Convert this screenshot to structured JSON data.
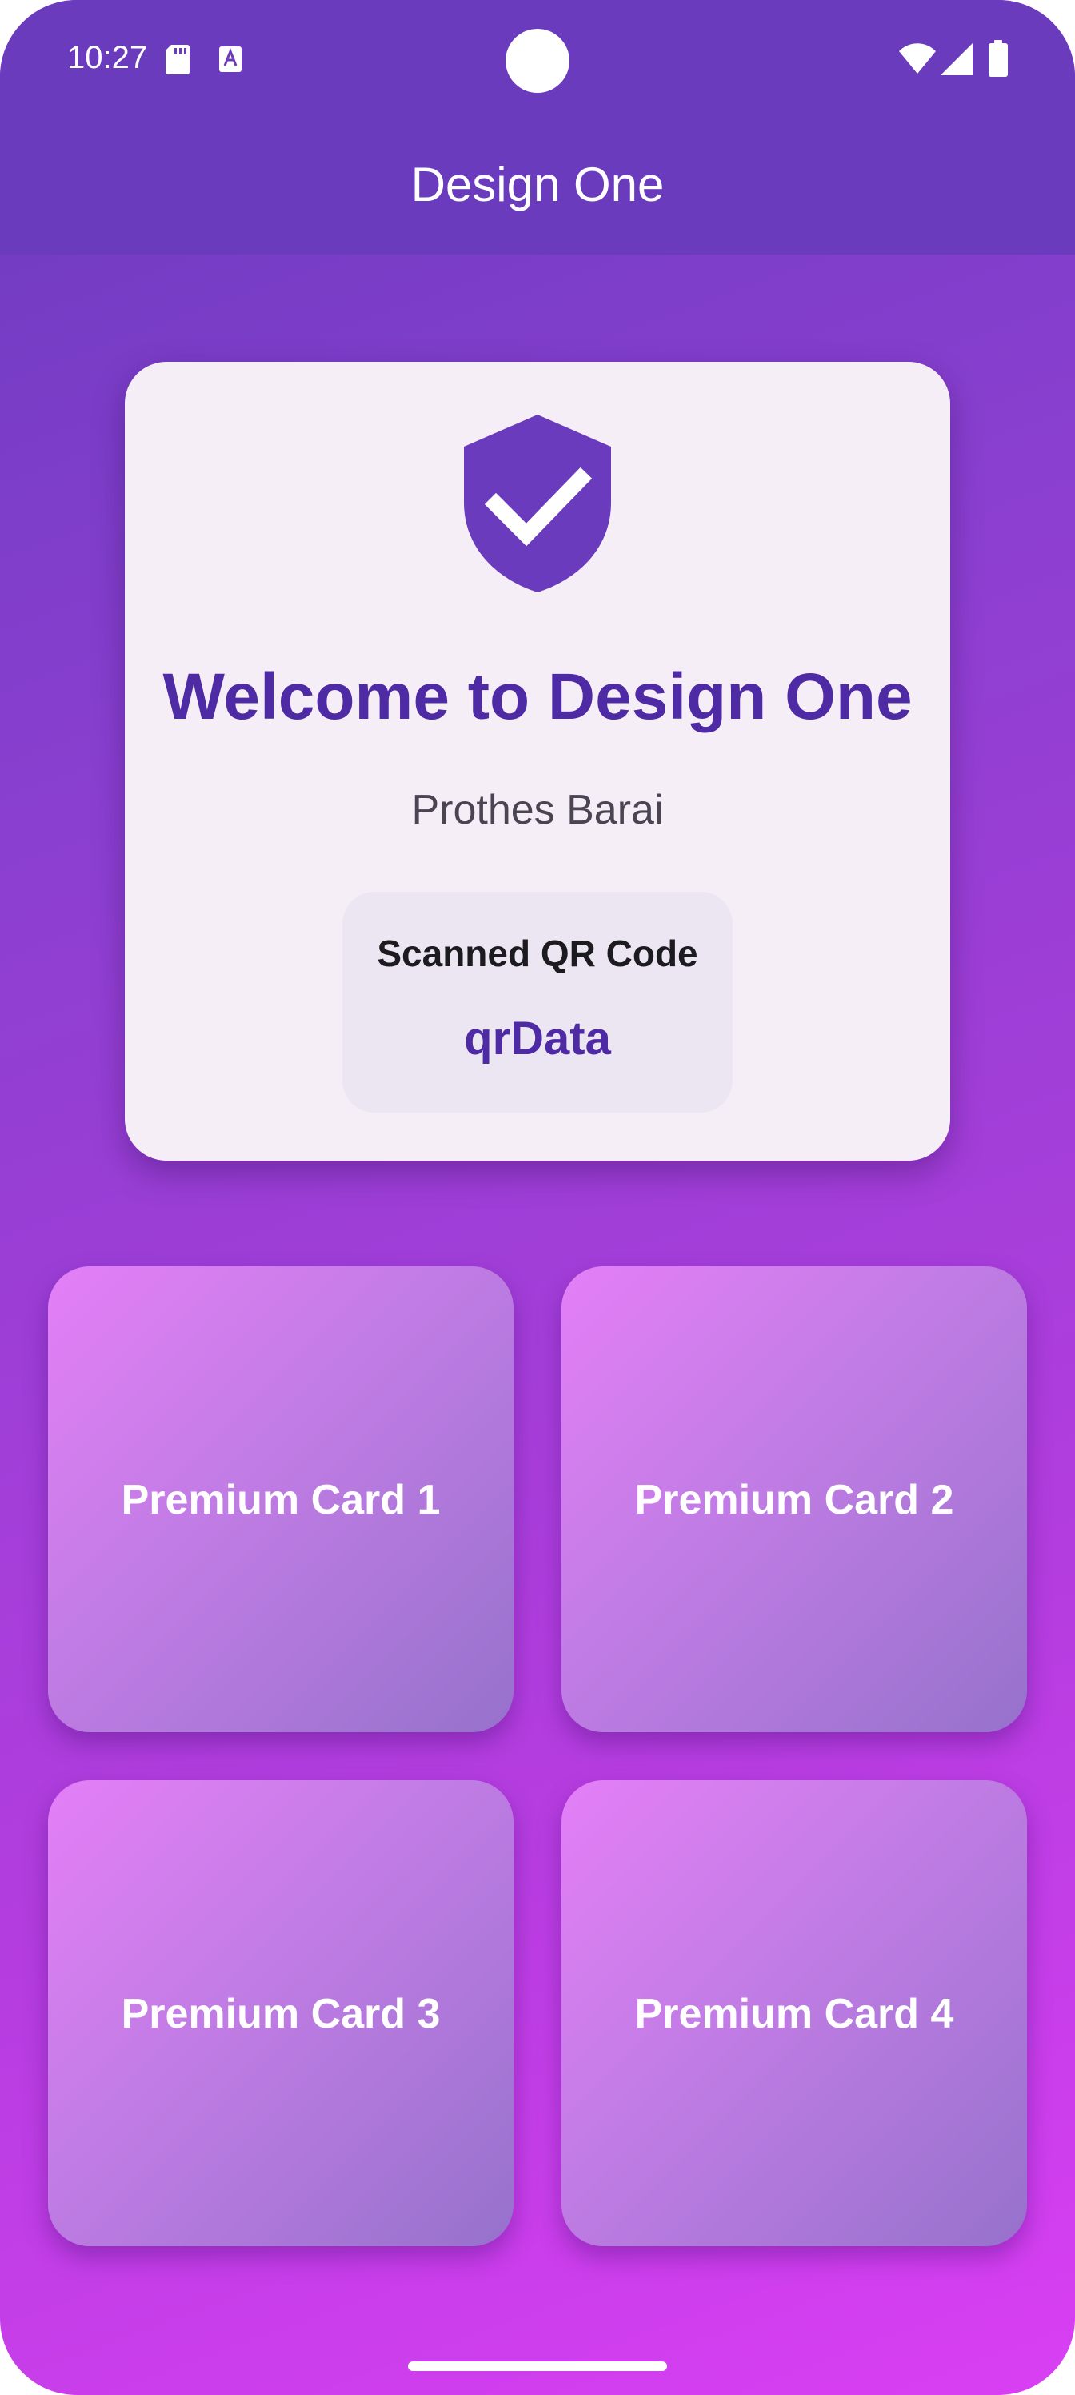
{
  "status_bar": {
    "time": "10:27"
  },
  "app_bar": {
    "title": "Design One"
  },
  "welcome_card": {
    "title": "Welcome to Design One",
    "subtitle": "Prothes Barai",
    "qr": {
      "label": "Scanned QR Code",
      "value": "qrData"
    }
  },
  "cards": [
    {
      "label": "Premium Card 1"
    },
    {
      "label": "Premium Card 2"
    },
    {
      "label": "Premium Card 3"
    },
    {
      "label": "Premium Card 4"
    }
  ],
  "colors": {
    "primary": "#6a3bbd",
    "accent": "#d93ff3",
    "title_text": "#4f2aa5",
    "card_background": "#f6eef7"
  },
  "icons": {
    "shield": "shield-check-icon",
    "sd_card": "sd-card-icon",
    "keyboard": "keyboard-a-icon",
    "wifi": "wifi-icon",
    "signal": "signal-icon",
    "battery": "battery-icon"
  }
}
